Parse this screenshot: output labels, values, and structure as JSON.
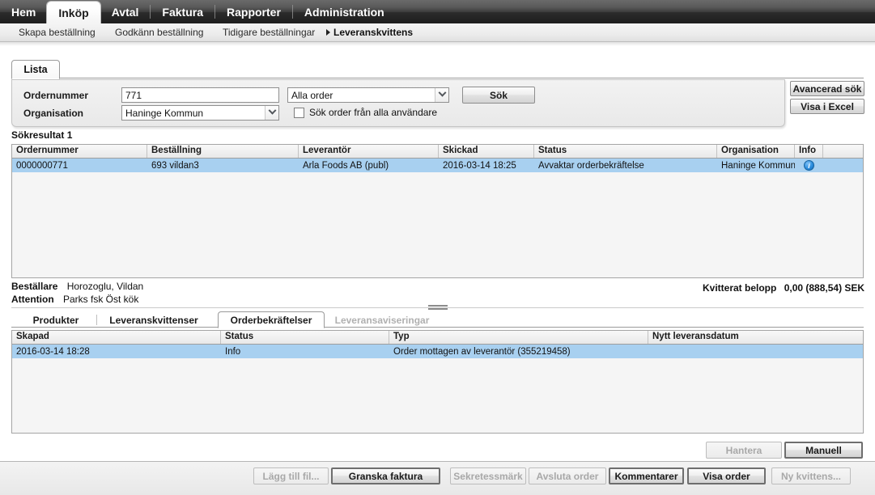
{
  "topnav": {
    "tabs": [
      {
        "label": "Hem",
        "active": false,
        "sep_after": false
      },
      {
        "label": "Inköp",
        "active": true,
        "sep_after": false
      },
      {
        "label": "Avtal",
        "active": false,
        "sep_after": true
      },
      {
        "label": "Faktura",
        "active": false,
        "sep_after": true
      },
      {
        "label": "Rapporter",
        "active": false,
        "sep_after": true
      },
      {
        "label": "Administration",
        "active": false,
        "sep_after": false
      }
    ]
  },
  "subnav": {
    "items": [
      {
        "label": "Skapa beställning",
        "selected": false
      },
      {
        "label": "Godkänn beställning",
        "selected": false
      },
      {
        "label": "Tidigare beställningar",
        "selected": false
      },
      {
        "label": "Leveranskvittens",
        "selected": true
      }
    ]
  },
  "panel": {
    "tab_label": "Lista"
  },
  "search": {
    "ordernummer_label": "Ordernummer",
    "ordernummer_value": "771",
    "organisation_label": "Organisation",
    "organisation_value": "Haninge Kommun",
    "orderfilter_value": "Alla order",
    "sok_button": "Sök",
    "checkbox_label": "Sök order från alla användare",
    "checkbox_checked": false,
    "avancerad_sok_button": "Avancerad sök",
    "visa_i_excel_button": "Visa i Excel"
  },
  "results": {
    "title": "Sökresultat 1",
    "columns": [
      "Ordernummer",
      "Beställning",
      "Leverantör",
      "Skickad",
      "Status",
      "Organisation",
      "Info"
    ],
    "rows": [
      {
        "ordernummer": "0000000771",
        "bestallning": "693 vildan3",
        "leverantor": "Arla Foods AB (publ)",
        "skickad": "2016-03-14 18:25",
        "status": "Avvaktar orderbekräftelse",
        "organisation": "Haninge Kommun",
        "info": "i",
        "selected": true
      }
    ]
  },
  "orderinfo": {
    "bestallare_label": "Beställare",
    "bestallare_value": "Horozoglu, Vildan",
    "attention_label": "Attention",
    "attention_value": "Parks fsk Öst kök",
    "amount_label": "Kvitterat belopp",
    "amount_value": "0,00 (888,54) SEK"
  },
  "lowertabs": {
    "items": [
      {
        "label": "Produkter",
        "active": false,
        "disabled": false
      },
      {
        "label": "Leveranskvittenser",
        "active": false,
        "disabled": false
      },
      {
        "label": "Orderbekräftelser",
        "active": true,
        "disabled": false
      },
      {
        "label": "Leveransaviseringar",
        "active": false,
        "disabled": true
      }
    ]
  },
  "detail": {
    "columns": [
      "Skapad",
      "Status",
      "Typ",
      "Nytt leveransdatum"
    ],
    "rows": [
      {
        "skapad": "2016-03-14 18:28",
        "status": "Info",
        "typ": "Order mottagen av leverantör (355219458)",
        "nytt_leveransdatum": "",
        "selected": true
      }
    ]
  },
  "detail_actions": {
    "hantera_button": "Hantera",
    "hantera_disabled": true,
    "manuell_button": "Manuell",
    "manuell_disabled": false
  },
  "footer": {
    "buttons": [
      {
        "label": "Lägg till fil...",
        "disabled": true,
        "strong": false
      },
      {
        "label": "Granska faktura",
        "disabled": false,
        "strong": true
      },
      {
        "label": "Sekretessmärk",
        "disabled": true,
        "strong": false
      },
      {
        "label": "Avsluta order",
        "disabled": true,
        "strong": false
      },
      {
        "label": "Kommentarer",
        "disabled": false,
        "strong": true
      },
      {
        "label": "Visa order",
        "disabled": false,
        "strong": true
      },
      {
        "label": "Ny kvittens...",
        "disabled": true,
        "strong": false
      }
    ]
  },
  "colors": {
    "selection_blue": "#a8d0f0",
    "nav_dark": "#3a3a3a",
    "info_blue": "#2d8ede"
  }
}
